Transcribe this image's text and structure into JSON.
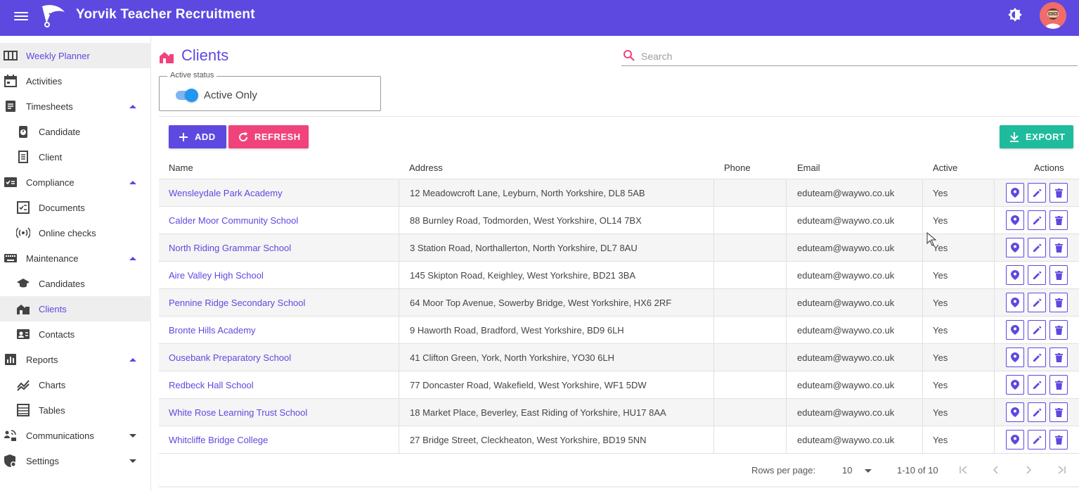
{
  "app": {
    "title": "Yorvik Teacher Recruitment"
  },
  "sidebar": {
    "items": [
      {
        "label": "Weekly Planner"
      },
      {
        "label": "Activities"
      },
      {
        "label": "Timesheets"
      },
      {
        "label": "Candidate"
      },
      {
        "label": "Client"
      },
      {
        "label": "Compliance"
      },
      {
        "label": "Documents"
      },
      {
        "label": "Online checks"
      },
      {
        "label": "Maintenance"
      },
      {
        "label": "Candidates"
      },
      {
        "label": "Clients"
      },
      {
        "label": "Contacts"
      },
      {
        "label": "Reports"
      },
      {
        "label": "Charts"
      },
      {
        "label": "Tables"
      },
      {
        "label": "Communications"
      },
      {
        "label": "Settings"
      }
    ]
  },
  "page": {
    "title": "Clients"
  },
  "search": {
    "placeholder": "Search",
    "value": ""
  },
  "filter": {
    "legend": "Active status",
    "toggle_label": "Active Only",
    "toggle_on": true
  },
  "toolbar": {
    "add_label": "ADD",
    "refresh_label": "REFRESH",
    "export_label": "EXPORT"
  },
  "table": {
    "columns": [
      "Name",
      "Address",
      "Phone",
      "Email",
      "Active",
      "Actions"
    ],
    "rows": [
      {
        "name": "Wensleydale Park Academy",
        "address": "12 Meadowcroft Lane, Leyburn, North Yorkshire, DL8 5AB",
        "phone": "",
        "email": "eduteam@waywo.co.uk",
        "active": "Yes"
      },
      {
        "name": "Calder Moor Community School",
        "address": "88 Burnley Road, Todmorden, West Yorkshire, OL14 7BX",
        "phone": "",
        "email": "eduteam@waywo.co.uk",
        "active": "Yes"
      },
      {
        "name": "North Riding Grammar School",
        "address": "3 Station Road, Northallerton, North Yorkshire, DL7 8AU",
        "phone": "",
        "email": "eduteam@waywo.co.uk",
        "active": "Yes"
      },
      {
        "name": "Aire Valley High School",
        "address": "145 Skipton Road, Keighley, West Yorkshire, BD21 3BA",
        "phone": "",
        "email": "eduteam@waywo.co.uk",
        "active": "Yes"
      },
      {
        "name": "Pennine Ridge Secondary School",
        "address": "64 Moor Top Avenue, Sowerby Bridge, West Yorkshire, HX6 2RF",
        "phone": "",
        "email": "eduteam@waywo.co.uk",
        "active": "Yes"
      },
      {
        "name": "Bronte Hills Academy",
        "address": "9 Haworth Road, Bradford, West Yorkshire, BD9 6LH",
        "phone": "",
        "email": "eduteam@waywo.co.uk",
        "active": "Yes"
      },
      {
        "name": "Ousebank Preparatory School",
        "address": "41 Clifton Green, York, North Yorkshire, YO30 6LH",
        "phone": "",
        "email": "eduteam@waywo.co.uk",
        "active": "Yes"
      },
      {
        "name": "Redbeck Hall School",
        "address": "77 Doncaster Road, Wakefield, West Yorkshire, WF1 5DW",
        "phone": "",
        "email": "eduteam@waywo.co.uk",
        "active": "Yes"
      },
      {
        "name": "White Rose Learning Trust School",
        "address": "18 Market Place, Beverley, East Riding of Yorkshire, HU17 8AA",
        "phone": "",
        "email": "eduteam@waywo.co.uk",
        "active": "Yes"
      },
      {
        "name": "Whitcliffe Bridge College",
        "address": "27 Bridge Street, Cleckheaton, West Yorkshire, BD19 5NN",
        "phone": "",
        "email": "eduteam@waywo.co.uk",
        "active": "Yes"
      }
    ]
  },
  "pagination": {
    "rows_per_page_label": "Rows per page:",
    "rows_per_page": "10",
    "range": "1-10 of 10"
  },
  "colors": {
    "primary": "#5d49e0",
    "accent": "#f0437c",
    "success": "#1ebc9c"
  }
}
